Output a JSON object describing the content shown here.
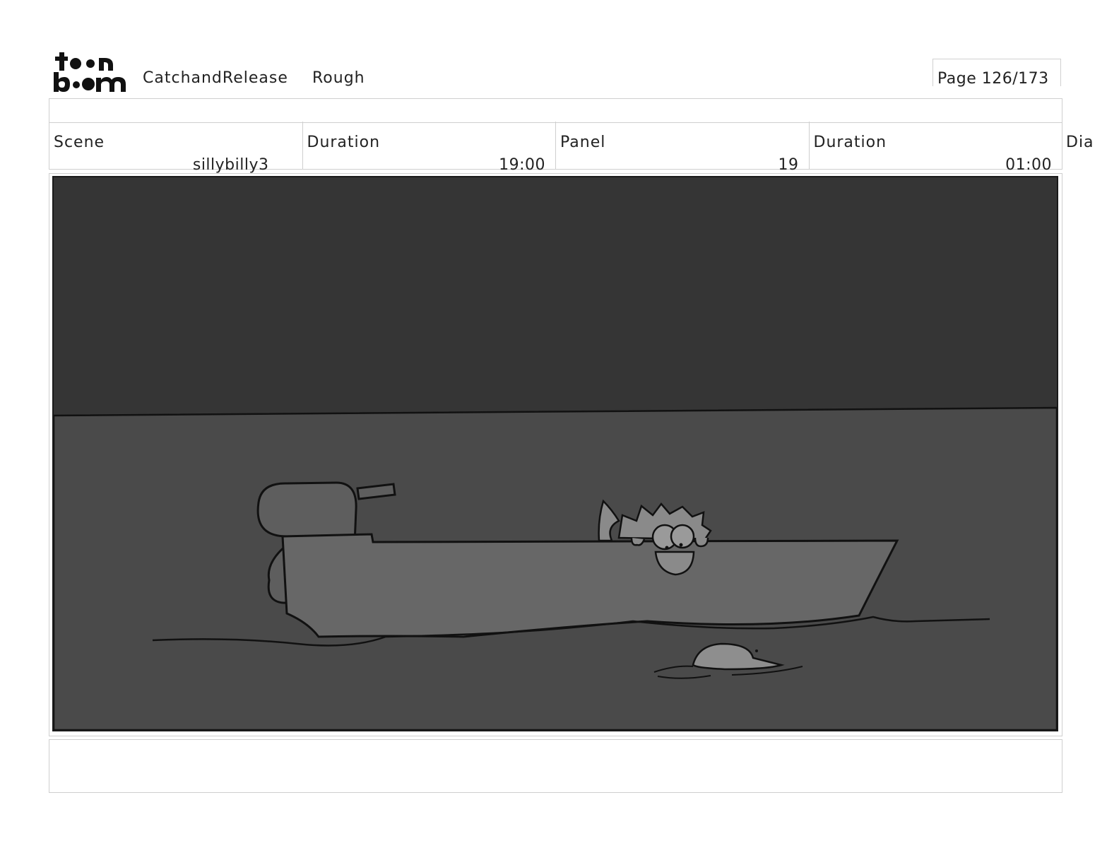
{
  "header": {
    "logo_text": "toonboom",
    "project": "CatchandRelease",
    "stage": "Rough",
    "page": "Page 126/173"
  },
  "panel_info": {
    "scene_label": "Scene",
    "scene_value": "sillybilly3",
    "scene_duration_label": "Duration",
    "scene_duration_value": "19:00",
    "panel_label": "Panel",
    "panel_value": "19",
    "panel_duration_label": "Duration",
    "panel_duration_value": "01:00",
    "dialogue_label": "Dia"
  },
  "colors": {
    "sky": "#353535",
    "water": "#4a4a4a",
    "boat": "#676767",
    "line": "#111111"
  }
}
